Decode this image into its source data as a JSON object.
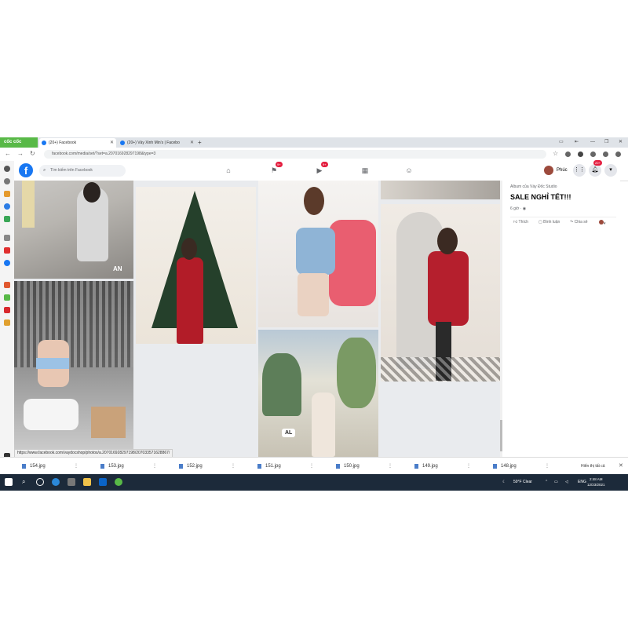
{
  "browser": {
    "brand": "cốc cốc",
    "tabs": [
      {
        "label": "(20+) Facebook",
        "active": true
      },
      {
        "label": "(20+) Váy Xinh Min's | Facebo",
        "active": false
      }
    ],
    "url": "facebook.com/media/set/?set=a.207016928297198&type=3",
    "status_url": "https://www.facebook.com/vaydocshop/photos/a.207016928297198/207033571628867/"
  },
  "fb": {
    "search_placeholder": "Tìm kiếm trên Facebook",
    "groups_badge": "9+",
    "watch_badge": "9+",
    "profile_name": "Phúc",
    "notif_badge": "20+"
  },
  "photos": [
    {
      "label": "AN"
    },
    {
      "label": ""
    },
    {
      "label": ""
    },
    {
      "label": ""
    },
    {
      "label": ""
    },
    {
      "label": "AL"
    }
  ],
  "post": {
    "album": "Album của Váy Đốc Studio",
    "title": "SALE NGHỈ TẾT!!!",
    "time": "6 giờ · ",
    "like": "Thích",
    "comment": "Bình luận",
    "share": "Chia sẻ"
  },
  "downloads": [
    "154.jpg",
    "153.jpg",
    "152.jpg",
    "151.jpg",
    "150.jpg",
    "149.jpg",
    "148.jpg"
  ],
  "downloads_show_all": "Hiển thị tất cả",
  "taskbar": {
    "weather": "59°F  Clear",
    "lang": "ENG",
    "time": "2:48 AM",
    "date": "12/23/2021"
  },
  "colors": {
    "facebook_blue": "#1877f2",
    "coccoc_green": "#58b947",
    "taskbar": "#1c2a3a"
  },
  "icons": [
    "home-icon",
    "flag-icon",
    "watch-icon",
    "store-icon",
    "groups-icon",
    "menu-icon",
    "bell-icon",
    "caret-icon",
    "search-icon"
  ]
}
